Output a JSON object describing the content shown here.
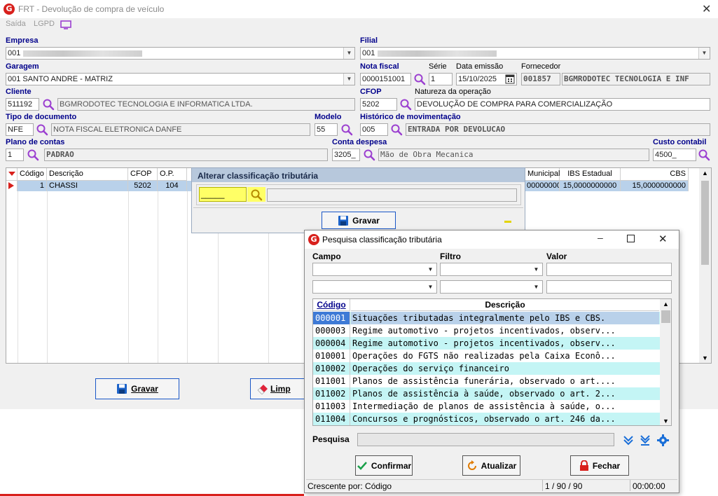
{
  "window": {
    "title": "FRT - Devolução de compra de veículo",
    "logo_letter": "G"
  },
  "menu": {
    "saida": "Saída",
    "lgpd": "LGPD"
  },
  "form": {
    "empresa": {
      "label": "Empresa",
      "value": "001"
    },
    "filial": {
      "label": "Filial",
      "value": "001"
    },
    "garagem": {
      "label": "Garagem",
      "value": "001 SANTO ANDRE - MATRIZ"
    },
    "nota_fiscal": {
      "label": "Nota fiscal",
      "value": "0000151001"
    },
    "serie": {
      "label": "Série",
      "value": "1"
    },
    "data_emissao": {
      "label": "Data emissão",
      "value": "15/10/2025"
    },
    "fornecedor": {
      "label": "Fornecedor",
      "code": "001857",
      "name": "BGMRODOTEC TECNOLOGIA E INF"
    },
    "cliente": {
      "label": "Cliente",
      "code": "511192",
      "name": "BGMRODOTEC TECNOLOGIA E INFORMATICA LTDA."
    },
    "cfop": {
      "label": "CFOP",
      "value": "5202"
    },
    "natureza": {
      "label": "Natureza da operação",
      "value": "DEVOLUÇÃO DE COMPRA PARA COMERCIALIZAÇÃO"
    },
    "tipo_doc": {
      "label": "Tipo de documento",
      "code": "NFE",
      "name": "NOTA FISCAL ELETRONICA DANFE"
    },
    "modelo": {
      "label": "Modelo",
      "value": "55"
    },
    "historico": {
      "label": "Histórico de movimentação",
      "code": "005",
      "name": "ENTRADA POR DEVOLUCAO"
    },
    "plano_contas": {
      "label": "Plano de contas",
      "code": "1",
      "name": "PADRAO"
    },
    "conta_despesa": {
      "label": "Conta despesa",
      "code": "3205_",
      "name": "Mão de Obra Mecanica"
    },
    "custo_contabil": {
      "label": "Custo contabil",
      "value": "4500_"
    }
  },
  "grid": {
    "headers": [
      "Código",
      "Descrição",
      "CFOP",
      "O.P.",
      "Municipal",
      "IBS Estadual",
      "CBS"
    ],
    "row": {
      "codigo": "1",
      "descricao": "CHASSI",
      "cfop": "5202",
      "op": "104",
      "municipal": "00000000",
      "ibs": "15,0000000000",
      "cbs": "15,0000000000"
    }
  },
  "buttons": {
    "gravar": "Gravar",
    "limpar": "Limp"
  },
  "popup_alterar": {
    "title": "Alterar classificação tributária",
    "input_value": "_____",
    "gravar": "Gravar"
  },
  "dialog": {
    "title": "Pesquisa classificação tributária",
    "campo_label": "Campo",
    "filtro_label": "Filtro",
    "valor_label": "Valor",
    "col_codigo": "Código",
    "col_descricao": "Descrição",
    "rows": [
      {
        "codigo": "000001",
        "descricao": "Situações tributadas integralmente pelo IBS e CBS."
      },
      {
        "codigo": "000003",
        "descricao": "Regime automotivo - projetos incentivados, observ..."
      },
      {
        "codigo": "000004",
        "descricao": "Regime automotivo - projetos incentivados, observ..."
      },
      {
        "codigo": "010001",
        "descricao": "Operações do FGTS não realizadas pela Caixa Econô..."
      },
      {
        "codigo": "010002",
        "descricao": "Operações do serviço financeiro"
      },
      {
        "codigo": "011001",
        "descricao": "Planos de assistência funerária, observado o art...."
      },
      {
        "codigo": "011002",
        "descricao": "Planos de assistência à saúde, observado o art. 2..."
      },
      {
        "codigo": "011003",
        "descricao": "Intermediação de planos de assistência à saúde, o..."
      },
      {
        "codigo": "011004",
        "descricao": "Concursos e prognósticos, observado o art. 246 da..."
      }
    ],
    "pesquisa_label": "Pesquisa",
    "confirmar": "Confirmar",
    "atualizar": "Atualizar",
    "fechar": "Fechar",
    "status_order": "Crescente por: Código",
    "status_count": "1 / 90 / 90",
    "status_time": "00:00:00"
  },
  "colors": {
    "label_blue": "#00008b",
    "selection": "#b9d1ea",
    "row_alt": "#c4f5f5",
    "row_selected": "#3e7ad6",
    "highlight_yellow": "#ffff66",
    "accent_purple": "#9b3fd0"
  }
}
